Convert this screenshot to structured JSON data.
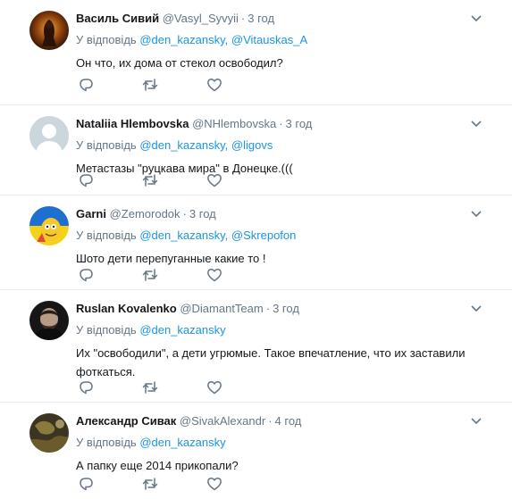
{
  "reply_prefix": "У відповідь",
  "tweets": [
    {
      "name": "Василь Сивий",
      "handle": "@Vasyl_Syvyii",
      "time": "3 год",
      "reply_to": [
        "@den_kazansky,",
        "@Vitauskas_A"
      ],
      "text": "Он что, их дома от стекол освободил?"
    },
    {
      "name": "Nataliia Hlembovska",
      "handle": "@NHlembovska",
      "time": "3 год",
      "reply_to": [
        "@den_kazansky,",
        "@ligovs"
      ],
      "text": "Метастазы \"руцкава мира\" в Донецке.((("
    },
    {
      "name": "Garni",
      "handle": "@Zemorodok",
      "time": "3 год",
      "reply_to": [
        "@den_kazansky,",
        "@Skrepofon"
      ],
      "text": "Шото дети перепуганные какие то !"
    },
    {
      "name": "Ruslan Kovalenko",
      "handle": "@DiamantTeam",
      "time": "3 год",
      "reply_to": [
        "@den_kazansky"
      ],
      "text": "Их \"освободили\", а дети угрюмые. Такое впечатление, что их заставили фоткаться."
    },
    {
      "name": "Александр Сивак",
      "handle": "@SivakAlexandr",
      "time": "4 год",
      "reply_to": [
        "@den_kazansky"
      ],
      "text": "А папку еще 2014 прикопали?"
    }
  ],
  "icons": {
    "reply": "reply-icon",
    "retweet": "retweet-icon",
    "like": "like-icon",
    "caret": "chevron-down-icon"
  },
  "colors": {
    "link": "#1b95e0",
    "muted": "#657786",
    "text": "#14171a",
    "divider": "#e6ecf0"
  }
}
